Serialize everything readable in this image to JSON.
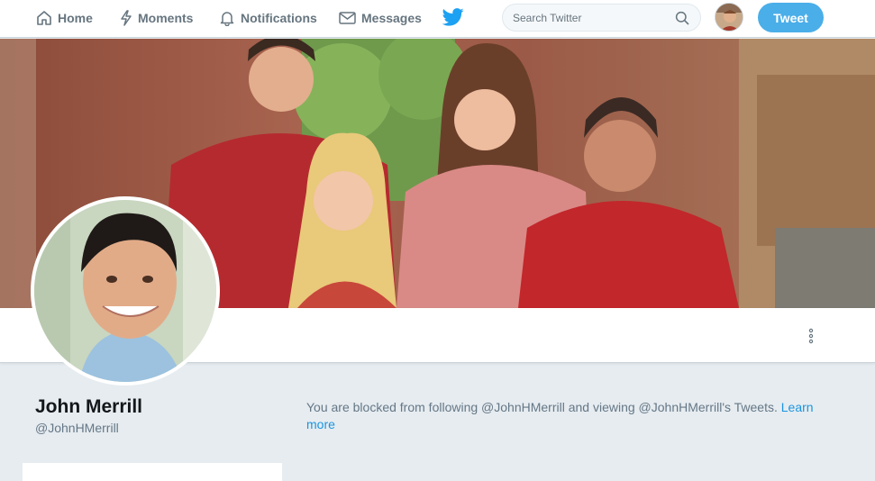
{
  "nav": {
    "home_label": "Home",
    "moments_label": "Moments",
    "notifications_label": "Notifications",
    "messages_label": "Messages"
  },
  "search": {
    "placeholder": "Search Twitter"
  },
  "tweet_button_label": "Tweet",
  "profile": {
    "name": "John Merrill",
    "handle": "@JohnHMerrill",
    "blocked_message": "You are blocked from following @JohnHMerrill and viewing @JohnHMerrill's Tweets.",
    "learn_more_label": "Learn more"
  },
  "icons": {
    "home": "home-icon",
    "moments": "lightning-icon",
    "notifications": "bell-icon",
    "messages": "envelope-icon",
    "logo": "twitter-bird-icon",
    "search": "magnifier-icon",
    "more": "vertical-dots-icon"
  },
  "colors": {
    "brand": "#1da1f2",
    "tweet_button": "#4aaee8",
    "link": "#1b95e0",
    "page_bg": "#e6ecf0"
  }
}
